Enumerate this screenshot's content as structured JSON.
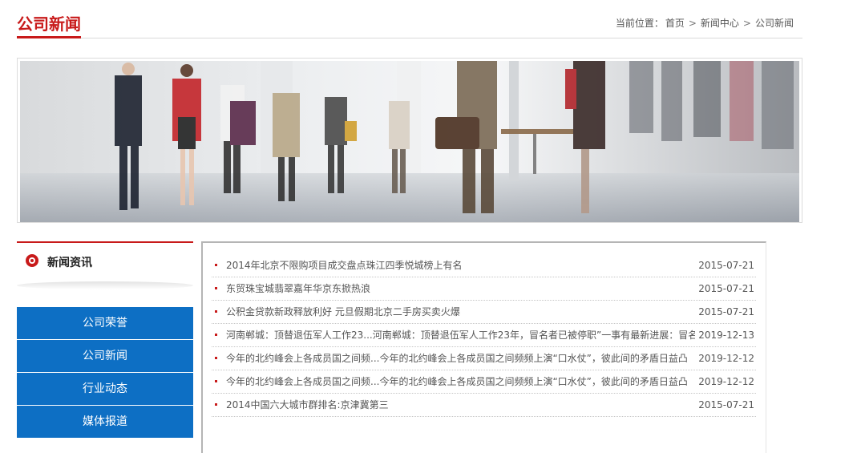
{
  "header": {
    "title": "公司新闻",
    "breadcrumb": {
      "prefix": "当前位置：",
      "items": [
        "首页",
        "新闻中心",
        "公司新闻"
      ],
      "separator": ">"
    }
  },
  "sidebar": {
    "heading": "新闻资讯",
    "items": [
      {
        "label": "公司荣誉"
      },
      {
        "label": "公司新闻"
      },
      {
        "label": "行业动态"
      },
      {
        "label": "媒体报道"
      }
    ]
  },
  "news": [
    {
      "title": "2014年北京不限购项目成交盘点珠江四季悦城榜上有名",
      "date": "2015-07-21"
    },
    {
      "title": "东贸珠宝城翡翠嘉年华京东掀热浪",
      "date": "2015-07-21"
    },
    {
      "title": "公积金贷款新政释放利好 元旦假期北京二手房买卖火爆",
      "date": "2015-07-21"
    },
    {
      "title": "河南郸城：顶替退伍军人工作23...河南郸城：顶替退伍军人工作23年，冒名者已被停职”一事有最新进展：冒名",
      "date": "2019-12-13"
    },
    {
      "title": "今年的北约峰会上各成员国之间频...今年的北约峰会上各成员国之间频频上演“口水仗”，彼此间的矛盾日益凸",
      "date": "2019-12-12"
    },
    {
      "title": "今年的北约峰会上各成员国之间频...今年的北约峰会上各成员国之间频频上演“口水仗”，彼此间的矛盾日益凸",
      "date": "2019-12-12"
    },
    {
      "title": "2014中国六大城市群排名:京津冀第三",
      "date": "2015-07-21"
    }
  ],
  "colors": {
    "accent_red": "#c81a1a",
    "nav_blue": "#0d6fc4"
  },
  "banner": {
    "icon": "business-people-walking-photo"
  }
}
